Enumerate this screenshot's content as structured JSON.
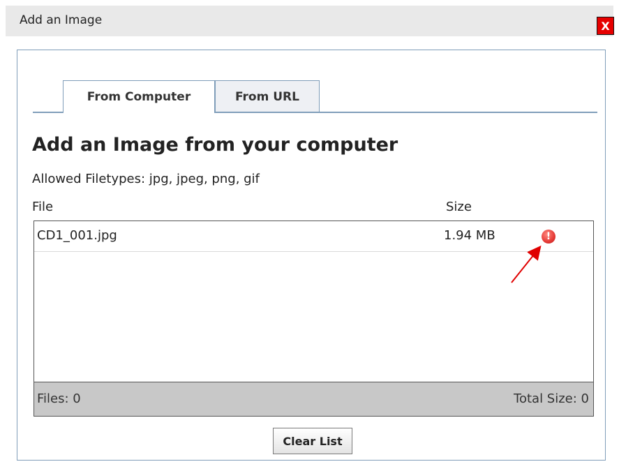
{
  "window": {
    "title": "Add an Image",
    "close_label": "X"
  },
  "tabs": [
    {
      "label": "From Computer",
      "active": true
    },
    {
      "label": "From URL",
      "active": false
    }
  ],
  "main": {
    "heading": "Add an Image from your computer",
    "allowed_filetypes": "Allowed Filetypes: jpg, jpeg, png, gif",
    "columns": {
      "file": "File",
      "size": "Size"
    },
    "files": [
      {
        "name": "CD1_001.jpg",
        "size": "1.94 MB",
        "status_icon": "error-icon",
        "status_glyph": "!"
      }
    ],
    "footer": {
      "files_count": "Files: 0",
      "total_size": "Total Size: 0"
    },
    "clear_button": "Clear List"
  },
  "colors": {
    "close_button": "#e60000",
    "border": "#7f9db9",
    "error_icon": "#e53935",
    "annotation_arrow": "#e00000"
  }
}
